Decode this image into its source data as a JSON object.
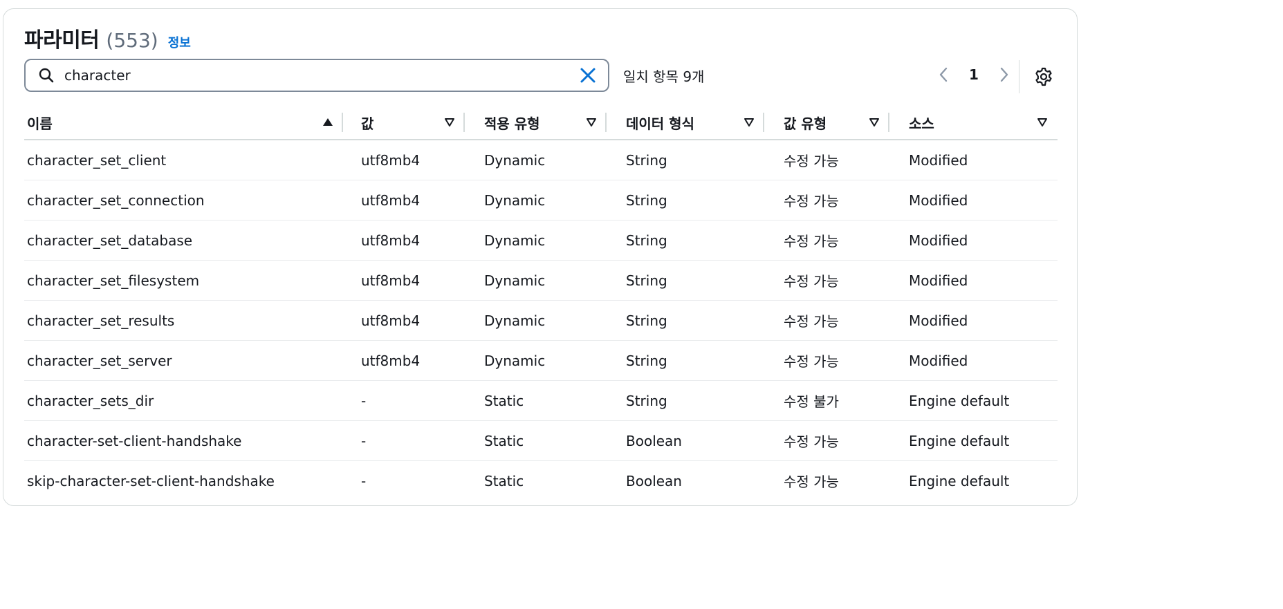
{
  "header": {
    "title": "파라미터",
    "count": "(553)",
    "info_link": "정보"
  },
  "search": {
    "value": "character",
    "placeholder": ""
  },
  "match_text": "일치 항목 9개",
  "pagination": {
    "current_page": "1"
  },
  "table": {
    "columns": [
      "이름",
      "값",
      "적용 유형",
      "데이터 형식",
      "값 유형",
      "소스"
    ],
    "rows": [
      [
        "character_set_client",
        "utf8mb4",
        "Dynamic",
        "String",
        "수정 가능",
        "Modified"
      ],
      [
        "character_set_connection",
        "utf8mb4",
        "Dynamic",
        "String",
        "수정 가능",
        "Modified"
      ],
      [
        "character_set_database",
        "utf8mb4",
        "Dynamic",
        "String",
        "수정 가능",
        "Modified"
      ],
      [
        "character_set_filesystem",
        "utf8mb4",
        "Dynamic",
        "String",
        "수정 가능",
        "Modified"
      ],
      [
        "character_set_results",
        "utf8mb4",
        "Dynamic",
        "String",
        "수정 가능",
        "Modified"
      ],
      [
        "character_set_server",
        "utf8mb4",
        "Dynamic",
        "String",
        "수정 가능",
        "Modified"
      ],
      [
        "character_sets_dir",
        "-",
        "Static",
        "String",
        "수정 불가",
        "Engine default"
      ],
      [
        "character-set-client-handshake",
        "-",
        "Static",
        "Boolean",
        "수정 가능",
        "Engine default"
      ],
      [
        "skip-character-set-client-handshake",
        "-",
        "Static",
        "Boolean",
        "수정 가능",
        "Engine default"
      ]
    ]
  },
  "colors": {
    "accent": "#0972d3",
    "border": "#7d8998",
    "divider": "#d5dbdb",
    "muted": "#5f6b7a"
  },
  "icons": [
    "search-icon",
    "clear-icon",
    "chevron-left-icon",
    "chevron-right-icon",
    "settings-gear-icon",
    "sort-ascending-icon",
    "sort-descending-icon"
  ]
}
